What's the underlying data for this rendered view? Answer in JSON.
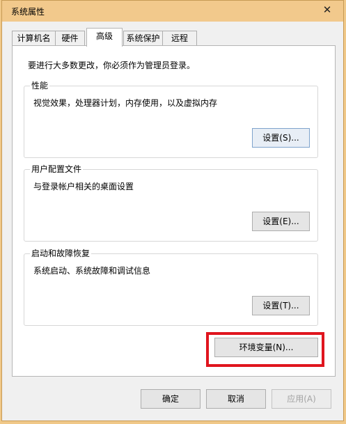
{
  "window": {
    "title": "系统属性",
    "close_glyph": "✕"
  },
  "tabs": [
    {
      "label": "计算机名",
      "active": false
    },
    {
      "label": "硬件",
      "active": false
    },
    {
      "label": "高级",
      "active": true
    },
    {
      "label": "系统保护",
      "active": false
    },
    {
      "label": "远程",
      "active": false
    }
  ],
  "advanced": {
    "intro": "要进行大多数更改，你必须作为管理员登录。",
    "performance": {
      "title": "性能",
      "description": "视觉效果，处理器计划，内存使用，以及虚拟内存",
      "button": "设置(S)..."
    },
    "user_profiles": {
      "title": "用户配置文件",
      "description": "与登录帐户相关的桌面设置",
      "button": "设置(E)..."
    },
    "startup_recovery": {
      "title": "启动和故障恢复",
      "description": "系统启动、系统故障和调试信息",
      "button": "设置(T)..."
    },
    "environment_variables_button": "环境变量(N)...",
    "highlight_color": "#e0151e"
  },
  "footer": {
    "ok": "确定",
    "cancel": "取消",
    "apply": "应用(A)",
    "apply_enabled": false
  }
}
